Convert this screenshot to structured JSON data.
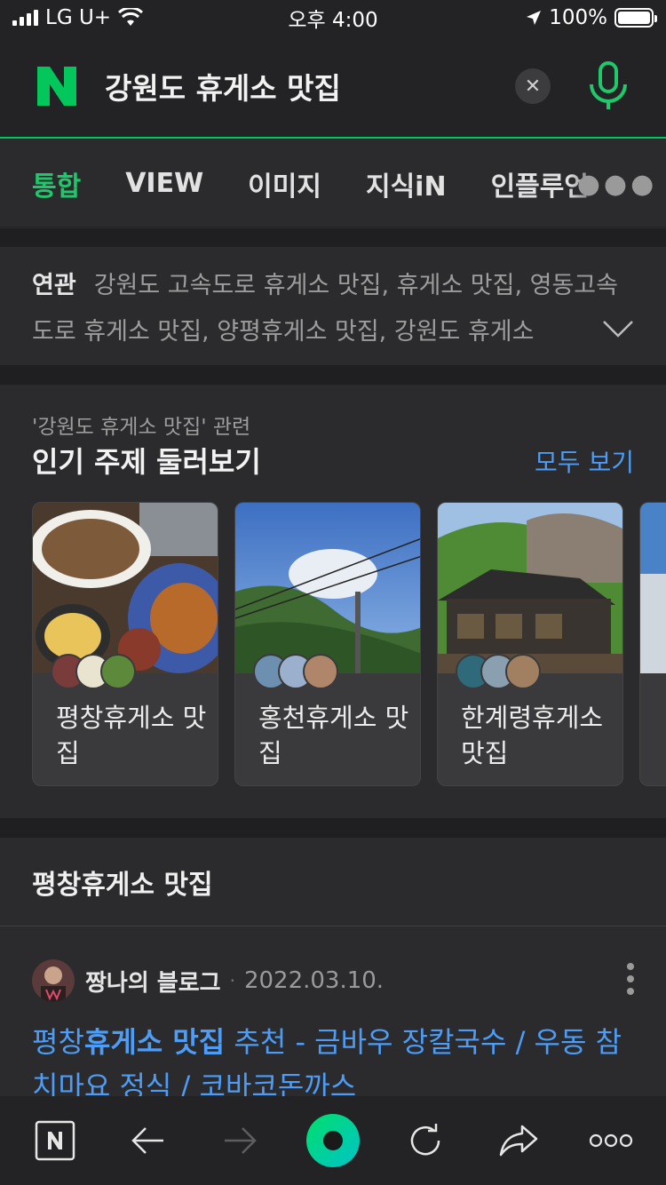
{
  "status_bar": {
    "carrier": "LG U+",
    "time": "오후 4:00",
    "battery": "100%",
    "battery_level": 1.0
  },
  "search": {
    "query": "강원도 휴게소 맛집",
    "clear_icon": "close-icon",
    "mic_icon": "microphone-icon",
    "brand_color": "#03c75a"
  },
  "tabs": [
    {
      "label": "통합",
      "active": true
    },
    {
      "label": "VIEW",
      "active": false
    },
    {
      "label": "이미지",
      "active": false
    },
    {
      "label": "지식iN",
      "active": false
    },
    {
      "label": "인플루언",
      "active": false
    }
  ],
  "related": {
    "label": "연관",
    "text": "강원도 고속도로 휴게소 맛집, 휴게소 맛집, 영동고속도로 휴게소 맛집, 양평휴게소 맛집, 강원도 휴게소"
  },
  "popular": {
    "subtitle": "'강원도 휴게소 맛집' 관련",
    "title": "인기 주제 둘러보기",
    "see_all": "모두 보기",
    "cards": [
      {
        "label": "평창휴게소 맛집"
      },
      {
        "label": "홍천휴게소 맛집"
      },
      {
        "label": "한계령휴게소 맛집"
      },
      {
        "label": ""
      }
    ]
  },
  "section": {
    "title": "평창휴게소 맛집"
  },
  "post": {
    "author": "짱나의 블로그",
    "date": "2022.03.10.",
    "title_prefix": "평창",
    "title_highlight": "휴게소 맛집",
    "title_rest": " 추천 - 금바우 장칼국수 / 우동 참치마요 정식 / 코바코돈까스"
  },
  "bottom_bar": {
    "icons": [
      "naver-home-icon",
      "back-arrow-icon",
      "forward-arrow-icon",
      "green-dot-icon",
      "refresh-icon",
      "share-icon",
      "more-icon"
    ]
  },
  "colors": {
    "accent_green": "#1fc86a",
    "link_blue": "#4d9cf5",
    "background": "#2b2b2d"
  }
}
